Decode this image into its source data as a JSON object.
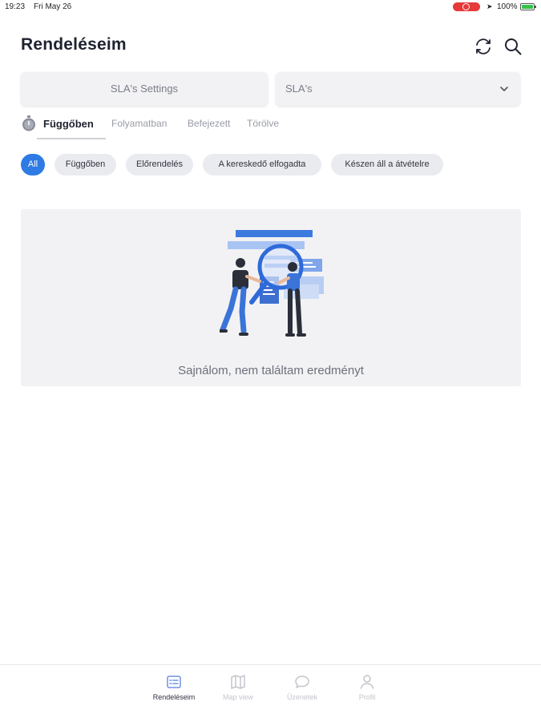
{
  "status_bar": {
    "time": "19:23",
    "date": "Fri May 26",
    "battery_pct": "100%"
  },
  "header": {
    "title": "Rendeléseim"
  },
  "filters": {
    "sla_settings_label": "SLA's Settings",
    "sla_select_value": "SLA's"
  },
  "tabs": [
    {
      "label": "Függőben",
      "active": true
    },
    {
      "label": "Folyamatban",
      "active": false
    },
    {
      "label": "Befejezett",
      "active": false
    },
    {
      "label": "Törölve",
      "active": false
    }
  ],
  "chips": [
    {
      "label": "All",
      "active": true
    },
    {
      "label": "Függőben",
      "active": false
    },
    {
      "label": "Előrendelés",
      "active": false
    },
    {
      "label": "A kereskedő elfogadta",
      "active": false
    },
    {
      "label": "Készen áll a átvételre",
      "active": false
    }
  ],
  "empty_state": {
    "message": "Sajnálom, nem találtam eredményt"
  },
  "bottom_nav": [
    {
      "label": "Rendeléseim",
      "icon": "orders-icon",
      "active": true
    },
    {
      "label": "Map view",
      "icon": "map-icon",
      "active": false
    },
    {
      "label": "Üzenetek",
      "icon": "chat-icon",
      "active": false
    },
    {
      "label": "Profil",
      "icon": "user-icon",
      "active": false
    }
  ],
  "colors": {
    "accent": "#2f7be5",
    "background": "#ffffff",
    "card": "#f2f2f4",
    "chip": "#eaebef",
    "recording": "#e5393a"
  }
}
